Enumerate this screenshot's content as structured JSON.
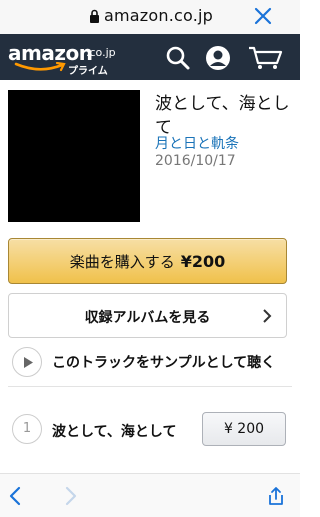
{
  "browser": {
    "url": "amazon.co.jp",
    "lock_icon": "lock-icon",
    "close_icon": "close-icon"
  },
  "header": {
    "logo_text": "amazon",
    "logo_tld": ".co.jp",
    "logo_prime": "プライム",
    "icons": [
      "search-icon",
      "account-icon",
      "cart-icon"
    ],
    "background": "#232f3e"
  },
  "product": {
    "title": "波として、海として",
    "artist": "月と日と軌条",
    "date": "2016/10/17"
  },
  "buy_button": {
    "label": "楽曲を購入する",
    "price": "¥200",
    "color": "#f0c14b"
  },
  "album_button": {
    "label": "収録アルバムを見る"
  },
  "sample": {
    "label": "このトラックをサンプルとして聴く"
  },
  "track": {
    "number": "1",
    "name": "波として、海として",
    "price_button": "¥ 200"
  },
  "toolbar": {
    "icons": [
      "back-icon",
      "forward-icon",
      "share-icon"
    ]
  }
}
